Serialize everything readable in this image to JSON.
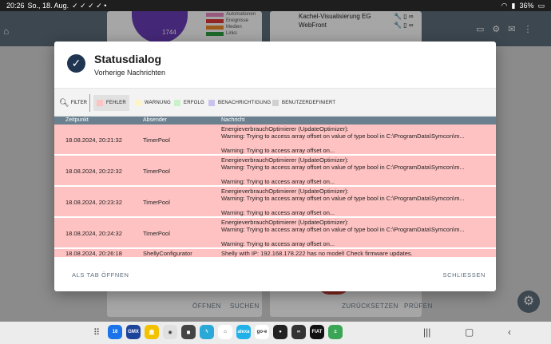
{
  "statusbar": {
    "time": "20:26",
    "date": "So., 18. Aug.",
    "battery": "36%",
    "notif_icons": "✓ ✓ ✓ ✓ •"
  },
  "background": {
    "pie_value": "1744",
    "legend": [
      {
        "label": "Automationen",
        "color": "#e889c2"
      },
      {
        "label": "Ereignisse",
        "color": "#e03b3b"
      },
      {
        "label": "Medien",
        "color": "#f08c2a"
      },
      {
        "label": "Links",
        "color": "#2ea043"
      }
    ],
    "tile_line1": "Kachel-Visualisierung EG",
    "tile_line2": "WebFront",
    "card3_btn1": "ÖFFNEN",
    "card3_btn2": "SUCHEN",
    "card4_btn1": "ZURÜCKSETZEN",
    "card4_btn2": "PRÜFEN"
  },
  "dialog": {
    "title": "Statusdialog",
    "subtitle": "Vorherige Nachrichten",
    "filter_label": "FILTER",
    "chips": [
      {
        "label": "FEHLER",
        "color": "#ffc2c2",
        "active": true
      },
      {
        "label": "WARNUNG",
        "color": "#fdf6c3",
        "active": false
      },
      {
        "label": "ERFOLG",
        "color": "#c9f2c9",
        "active": false
      },
      {
        "label": "BENACHRICHTIGUNG",
        "color": "#c9c4ee",
        "active": false
      },
      {
        "label": "BENUTZERDEFINIERT",
        "color": "#d0d0d0",
        "active": false
      }
    ],
    "columns": {
      "time": "Zeitpunkt",
      "sender": "Absender",
      "message": "Nachricht"
    },
    "rows": [
      {
        "time": "18.08.2024, 20:21:32",
        "sender": "TimerPool",
        "message": [
          "EnergieverbrauchOptimierer (UpdateOptimizer):",
          "Warning: Trying to access array offset on value of type bool in C:\\ProgramData\\Symcon\\m...",
          "",
          "Warning: Trying to access array offset on..."
        ]
      },
      {
        "time": "18.08.2024, 20:22:32",
        "sender": "TimerPool",
        "message": [
          "EnergieverbrauchOptimierer (UpdateOptimizer):",
          "Warning: Trying to access array offset on value of type bool in C:\\ProgramData\\Symcon\\m...",
          "",
          "Warning: Trying to access array offset on..."
        ]
      },
      {
        "time": "18.08.2024, 20:23:32",
        "sender": "TimerPool",
        "message": [
          "EnergieverbrauchOptimierer (UpdateOptimizer):",
          "Warning: Trying to access array offset on value of type bool in C:\\ProgramData\\Symcon\\m...",
          "",
          "Warning: Trying to access array offset on..."
        ]
      },
      {
        "time": "18.08.2024, 20:24:32",
        "sender": "TimerPool",
        "message": [
          "EnergieverbrauchOptimierer (UpdateOptimizer):",
          "Warning: Trying to access array offset on value of type bool in C:\\ProgramData\\Symcon\\m...",
          "",
          "Warning: Trying to access array offset on..."
        ]
      },
      {
        "time": "18.08.2024, 20:26:18",
        "sender": "ShellyConfigurator",
        "message": [
          "Shelly with IP: 192.168.178.222 has no model! Check firmware updates."
        ]
      }
    ],
    "footer_left": "ALS TAB ÖFFNEN",
    "footer_right": "SCHLIESSEN"
  },
  "dock": [
    {
      "label": "18",
      "color": "#1a73e8",
      "icon": "calendar-icon"
    },
    {
      "label": "GMX",
      "color": "#1c449b",
      "icon": "gmx-icon"
    },
    {
      "label": "🏛",
      "color": "#f2c200",
      "icon": "bank-icon"
    },
    {
      "label": "◉",
      "color": "#e0e0e0",
      "icon": "camera-app-icon"
    },
    {
      "label": "◼",
      "color": "#444444",
      "icon": "app-dark-icon"
    },
    {
      "label": "ϟ",
      "color": "#2aa8d8",
      "icon": "bolt-app-icon"
    },
    {
      "label": "⌂",
      "color": "#ffffff",
      "icon": "home-app-icon"
    },
    {
      "label": "alexa",
      "color": "#1fb2e8",
      "icon": "alexa-icon"
    },
    {
      "label": "go-e",
      "color": "#ffffff",
      "icon": "go-e-icon"
    },
    {
      "label": "●",
      "color": "#222222",
      "icon": "media-app-icon"
    },
    {
      "label": "∞",
      "color": "#333333",
      "icon": "loop-app-icon"
    },
    {
      "label": "FIAT",
      "color": "#111111",
      "icon": "fiat-icon"
    },
    {
      "label": "±",
      "color": "#3aa655",
      "icon": "calculator-icon"
    }
  ]
}
